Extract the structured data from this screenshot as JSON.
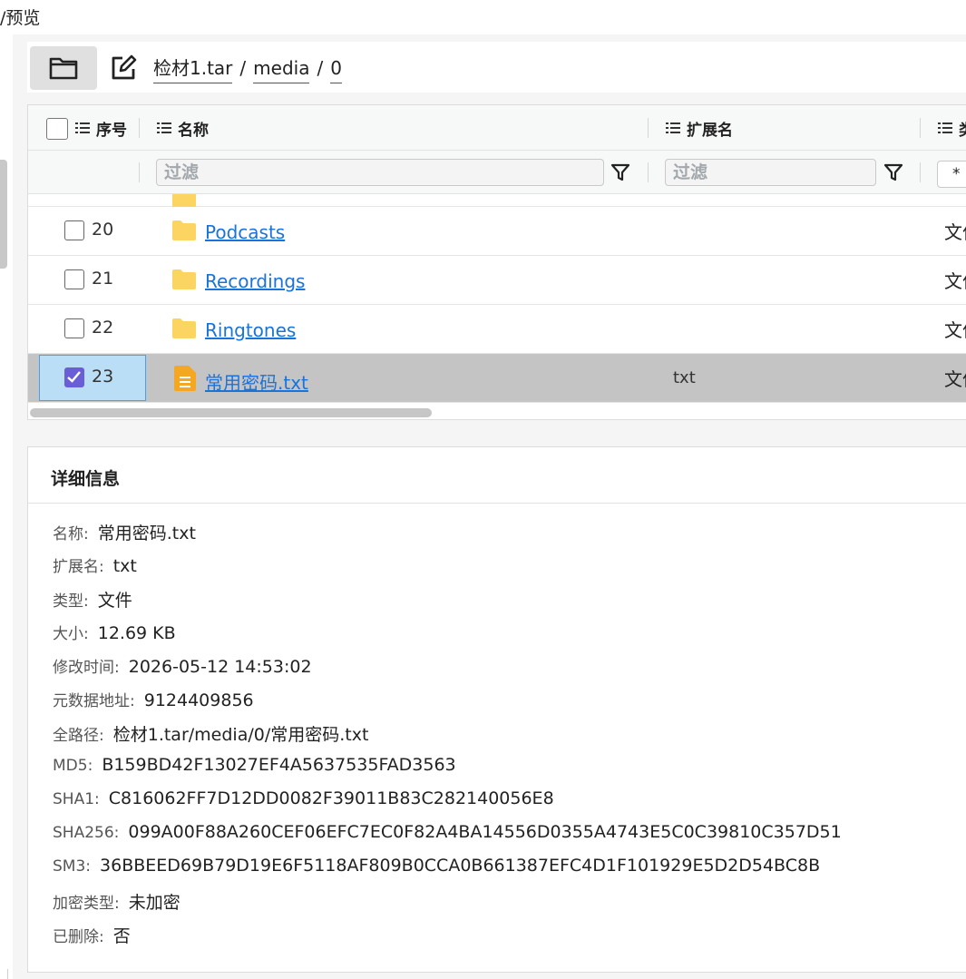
{
  "window": {
    "title": "/预览"
  },
  "breadcrumb": [
    "检材1.tar",
    "media",
    "0"
  ],
  "breadcrumb_sep": "/",
  "columns": {
    "index": "序号",
    "name": "名称",
    "extension": "扩展名",
    "type": "类"
  },
  "filters": {
    "name_placeholder": "过滤",
    "ext_placeholder": "过滤",
    "type_value": "*"
  },
  "rows": [
    {
      "index": "20",
      "name": "Podcasts",
      "ext": "",
      "type": "文件",
      "icon": "folder-icon",
      "selected": false
    },
    {
      "index": "21",
      "name": "Recordings",
      "ext": "",
      "type": "文件",
      "icon": "folder-icon",
      "selected": false
    },
    {
      "index": "22",
      "name": "Ringtones",
      "ext": "",
      "type": "文件",
      "icon": "folder-icon",
      "selected": false
    },
    {
      "index": "23",
      "name": "常用密码.txt",
      "ext": "txt",
      "type": "文件",
      "icon": "text-file-icon",
      "selected": true
    }
  ],
  "details": {
    "title": "详细信息",
    "fields": [
      {
        "label": "名称:",
        "value": "常用密码.txt"
      },
      {
        "label": "扩展名:",
        "value": "txt"
      },
      {
        "label": "类型:",
        "value": "文件"
      },
      {
        "label": "大小:",
        "value": "12.69 KB"
      },
      {
        "label": "修改时间:",
        "value": "2026-05-12 14:53:02"
      },
      {
        "label": "元数据地址:",
        "value": "9124409856"
      },
      {
        "label": "全路径:",
        "value": "检材1.tar/media/0/常用密码.txt"
      },
      {
        "label": "MD5:",
        "value": "B159BD42F13027EF4A5637535FAD3563"
      },
      {
        "label": "SHA1:",
        "value": "C816062FF7D12DD0082F39011B83C282140056E8"
      },
      {
        "label": "SHA256:",
        "value": "099A00F88A260CEF06EFC7EC0F82A4BA14556D0355A4743E5C0C39810C357D51"
      },
      {
        "label": "SM3:",
        "value": "36BBEED69B79D19E6F5118AF809B0CCA0B661387EFC4D1F101929E5D2D54BC8B"
      },
      {
        "label": "加密类型:",
        "value": "未加密"
      },
      {
        "label": "已删除:",
        "value": "否"
      }
    ]
  },
  "colors": {
    "link": "#1a73d9",
    "folder": "#fcd462",
    "text_file": "#f5a623",
    "selected_row": "#c4c4c4",
    "selected_cell": "#b9def5",
    "checkbox_checked": "#6a5ed6"
  }
}
